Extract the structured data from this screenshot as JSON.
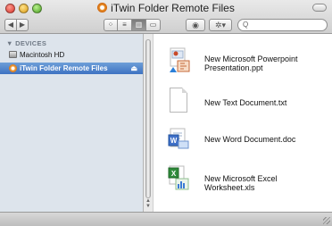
{
  "window": {
    "title": "iTwin Folder Remote Files"
  },
  "toolbar": {
    "back_symbol": "◀",
    "forward_symbol": "▶",
    "view_buttons": [
      "⁘",
      "≡",
      "▥",
      "▭"
    ],
    "eye_symbol": "◉",
    "gear_symbol": "✲▾",
    "search_symbol": "Q"
  },
  "sidebar": {
    "header": "▼ DEVICES",
    "items": [
      {
        "label": "Macintosh HD",
        "icon": "hard-drive-icon"
      },
      {
        "label": "iTwin Folder Remote Files",
        "icon": "itwin-icon",
        "selected": true,
        "eject": "⏏"
      }
    ]
  },
  "files": [
    {
      "name_lines": [
        "New Microsoft Powerpoint",
        "Presentation.ppt"
      ],
      "icon": "powerpoint-file-icon"
    },
    {
      "name_lines": [
        "New Text Document.txt"
      ],
      "icon": "text-file-icon"
    },
    {
      "name_lines": [
        "New Word Document.doc"
      ],
      "icon": "word-file-icon"
    },
    {
      "name_lines": [
        "New Microsoft Excel",
        "Worksheet.xls"
      ],
      "icon": "excel-file-icon"
    }
  ],
  "colors": {
    "sidebar_bg": "#dde4ec",
    "selection": "#3d72c2"
  }
}
